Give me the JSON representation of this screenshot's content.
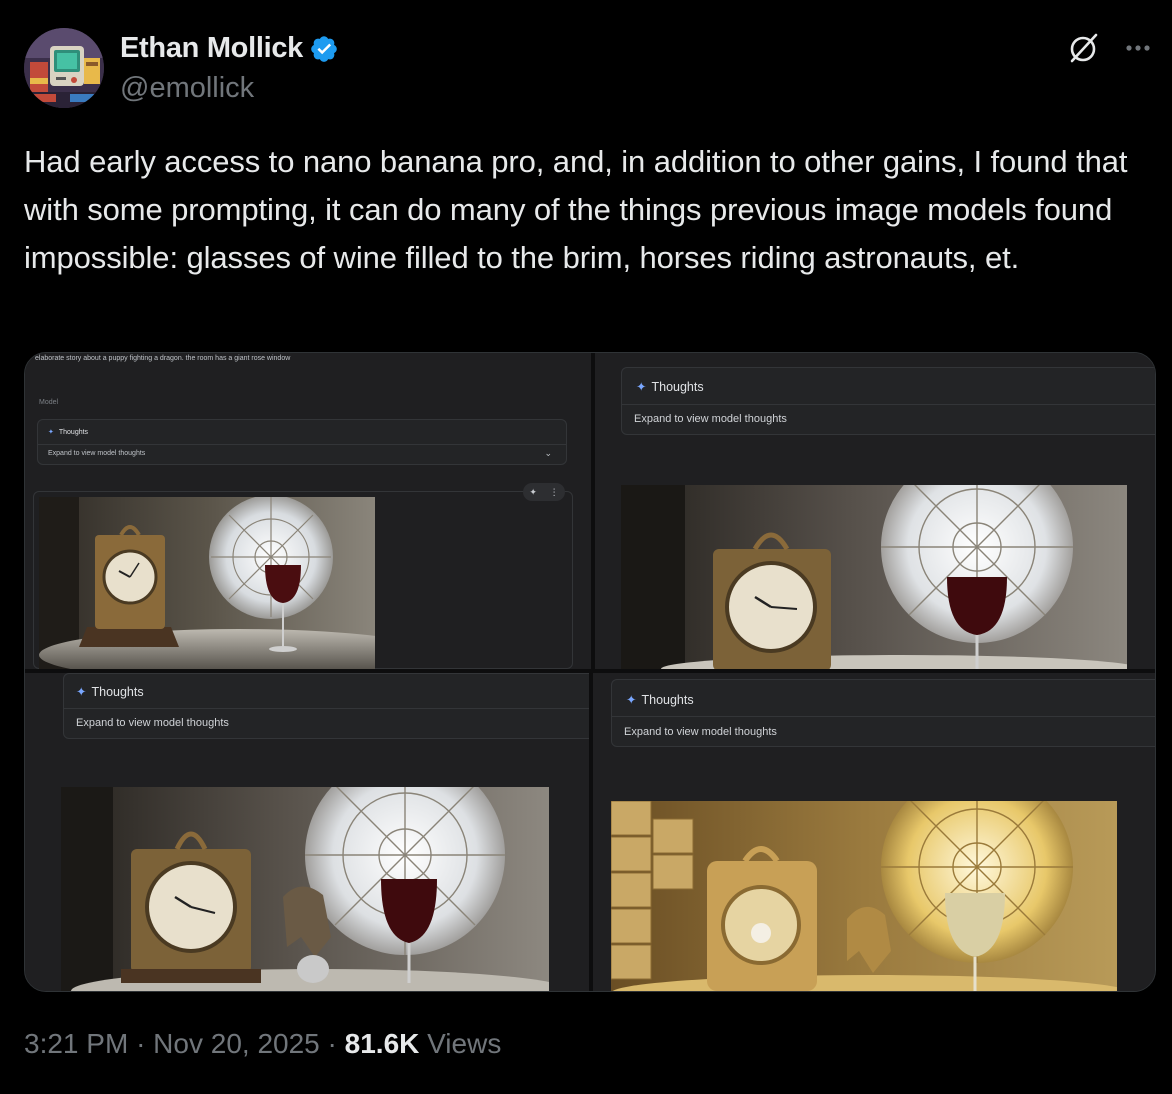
{
  "author": {
    "name": "Ethan Mollick",
    "handle": "@emollick",
    "verified_color": "#1d9bf0"
  },
  "tweet": {
    "text": "Had early access to nano banana pro, and, in addition to other gains, I found that with some prompting, it can do many of the things previous image models found impossible: glasses of wine filled to the brim, horses riding astronauts, et."
  },
  "media": {
    "panel1": {
      "prompt_text": "elaborate story about a puppy fighting a dragon. the room has a giant rose window",
      "model_label": "Model",
      "thoughts_label": "Thoughts",
      "expand_label": "Expand to view model thoughts"
    },
    "panel2": {
      "thoughts_label": "Thoughts",
      "expand_label": "Expand to view model thoughts"
    },
    "panel3": {
      "thoughts_label": "Thoughts",
      "expand_label": "Expand to view model thoughts"
    },
    "panel4": {
      "thoughts_label": "Thoughts",
      "expand_label": "Expand to view model thoughts"
    }
  },
  "footer": {
    "time": "3:21 PM",
    "dot": "·",
    "date": "Nov 20, 2025",
    "views_count": "81.6K",
    "views_label": "Views"
  },
  "icons": {
    "grok": "grok-icon",
    "more": "more-icon",
    "verified": "verified-badge-icon",
    "sparkle": "sparkle-icon"
  }
}
